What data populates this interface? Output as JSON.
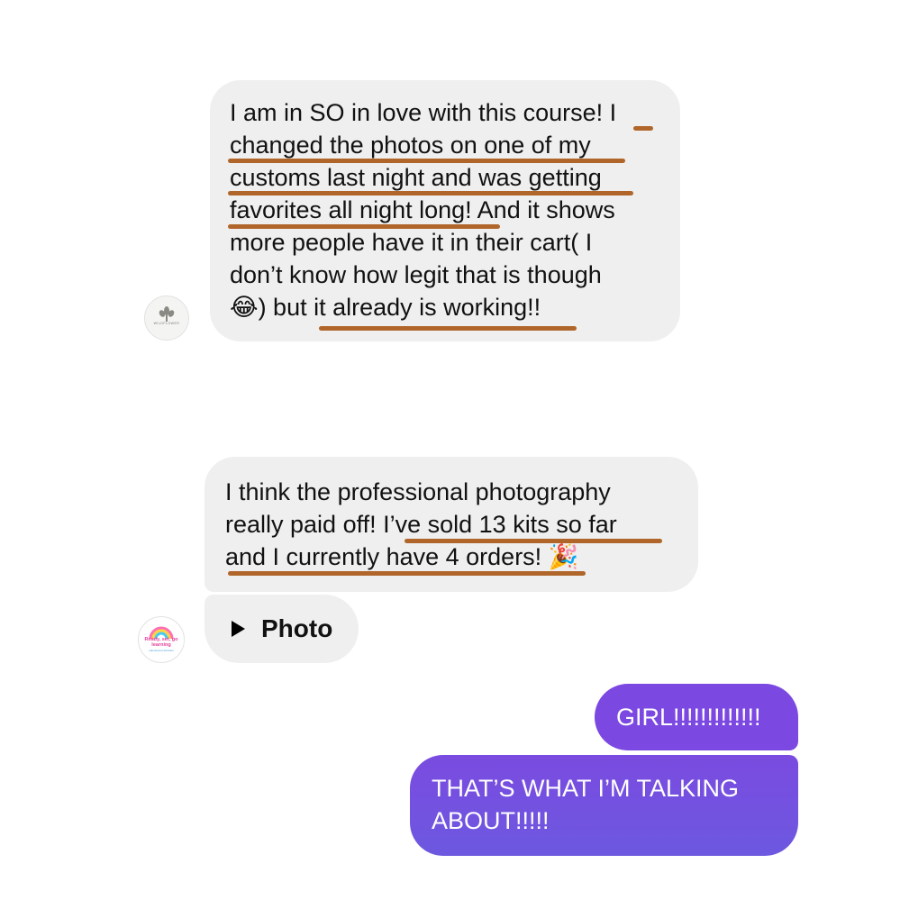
{
  "messages": {
    "first": {
      "lines": [
        "I am in SO in love with this course! I",
        "changed the photos on one of my",
        "customs last night and was getting",
        "favorites all night long! And it shows",
        "more people have it in their cart( I",
        "don’t know how legit that is though",
        ") but it already is working!!"
      ],
      "emoji": "😂"
    },
    "second": {
      "lines": [
        "I think the professional photography",
        "really paid off! I’ve sold 13 kits so far",
        "and I currently have 4 orders!"
      ],
      "emoji": "🎉"
    },
    "photo": {
      "label": "Photo",
      "icon": "play-icon"
    },
    "reply1": {
      "text": "GIRL!!!!!!!!!!!!!"
    },
    "reply2": {
      "lines": [
        "THAT’S WHAT I’M TALKING",
        "ABOUT!!!!!"
      ]
    }
  },
  "avatars": {
    "first": {
      "label": "WILDFLOWER"
    },
    "second": {
      "lines": [
        "Ready, set, go",
        "learning",
        "educational activities"
      ]
    }
  },
  "colors": {
    "incoming_bubble": "#efefef",
    "outgoing_bubble": "#7a4be0",
    "highlight_underline": "#b0662a"
  }
}
